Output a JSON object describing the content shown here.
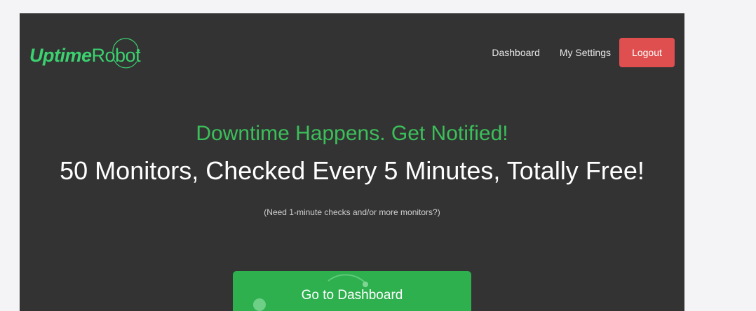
{
  "logo": {
    "part1": "Uptime",
    "part2": "Robot"
  },
  "nav": {
    "dashboard": "Dashboard",
    "settings": "My Settings",
    "logout": "Logout"
  },
  "hero": {
    "tagline": "Downtime Happens. Get Notified!",
    "headline": "50 Monitors, Checked Every 5 Minutes, Totally Free!",
    "subnote": "(Need 1-minute checks and/or more monitors?)",
    "cta": "Go to Dashboard"
  },
  "colors": {
    "background": "#333333",
    "brand_green": "#3bd16f",
    "cta_green": "#2eb04f",
    "logout_red": "#df4f4f",
    "page_outer": "#f4f4f6"
  },
  "icons": [
    "orbit-logo-icon"
  ]
}
